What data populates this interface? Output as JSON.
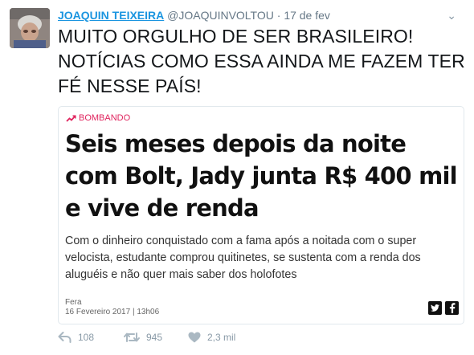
{
  "tweet": {
    "author_name": "JOAQUIN TEIXEIRA",
    "author_handle": "@JOAQUINVOLTOU",
    "separator": "·",
    "date": "17 de fev",
    "caret": "⌄",
    "text": "MUITO ORGULHO DE SER BRASILEIRO! NOTÍCIAS COMO ESSA AINDA ME FAZEM TER FÉ NESSE PAÍS!"
  },
  "card": {
    "tag": "BOMBANDO",
    "tag_icon": "trending-up-icon",
    "headline": "Seis meses depois da noite com Bolt, Jady junta R$ 400 mil e vive de renda",
    "summary": "Com o dinheiro conquistado com a fama após a noitada com o super velocista, estudante comprou quitinetes, se sustenta com a renda dos aluguéis e não quer mais saber dos holofotes",
    "source": "Fera",
    "timestamp": "16 Fevereiro 2017 | 13h06",
    "share_icons": [
      "twitter-icon",
      "facebook-icon"
    ]
  },
  "actions": {
    "reply_count": "108",
    "retweet_count": "945",
    "like_count": "2,3 mil"
  },
  "colors": {
    "link": "#1b95e0",
    "meta": "#657786",
    "tag": "#e0245e",
    "action": "#8899a6"
  }
}
